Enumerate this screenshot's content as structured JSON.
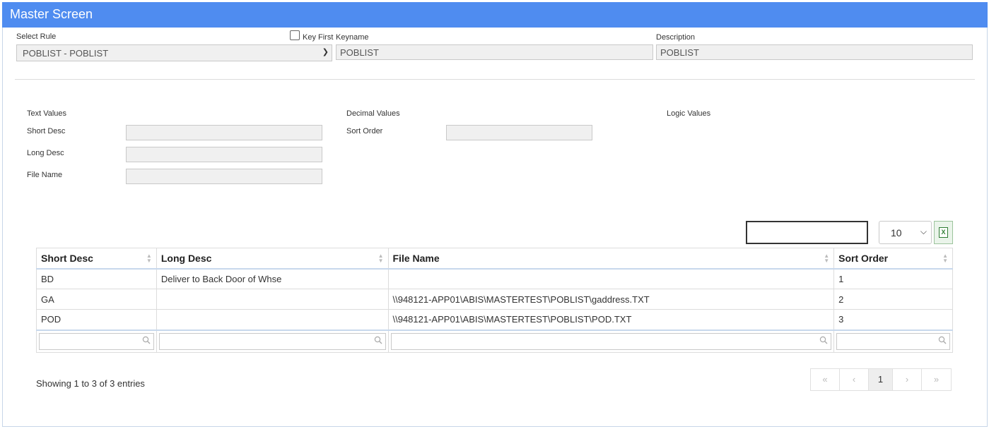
{
  "title": "Master Screen",
  "header": {
    "select_rule_label": "Select Rule",
    "select_rule_value": "POBLIST - POBLIST",
    "key_first_label": "Key First",
    "keyname_label": "Keyname",
    "keyname_value": "POBLIST",
    "description_label": "Description",
    "description_value": "POBLIST"
  },
  "sections": {
    "text_values": "Text Values",
    "decimal_values": "Decimal Values",
    "logic_values": "Logic Values"
  },
  "fields": {
    "short_desc": "Short Desc",
    "long_desc": "Long Desc",
    "file_name": "File Name",
    "sort_order": "Sort Order"
  },
  "table": {
    "page_length": "10",
    "columns": [
      "Short Desc",
      "Long Desc",
      "File Name",
      "Sort Order"
    ],
    "rows": [
      [
        "BD",
        "Deliver to Back Door of Whse",
        "",
        "1"
      ],
      [
        "GA",
        "",
        "\\\\948121-APP01\\ABIS\\MASTERTEST\\POBLIST\\gaddress.TXT",
        "2"
      ],
      [
        "POD",
        "",
        "\\\\948121-APP01\\ABIS\\MASTERTEST\\POBLIST\\POD.TXT",
        "3"
      ]
    ],
    "info": "Showing 1 to 3 of 3 entries"
  },
  "pagination": {
    "first": "«",
    "prev": "‹",
    "current": "1",
    "next": "›",
    "last": "»"
  },
  "colors": {
    "title_bar": "#4f8cf0",
    "excel_green": "#2e7d32"
  }
}
